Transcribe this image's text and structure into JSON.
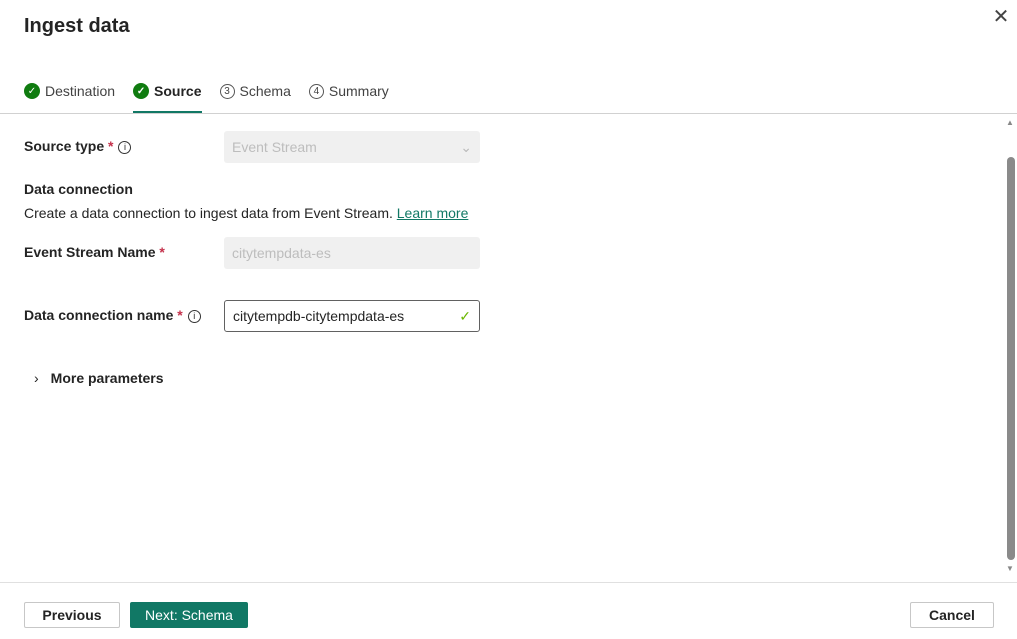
{
  "title": "Ingest data",
  "tabs": [
    {
      "label": "Destination",
      "state": "done"
    },
    {
      "label": "Source",
      "state": "active"
    },
    {
      "label": "Schema",
      "number": "3"
    },
    {
      "label": "Summary",
      "number": "4"
    }
  ],
  "form": {
    "source_type_label": "Source type",
    "source_type_value": "Event Stream",
    "data_connection_heading": "Data connection",
    "data_connection_desc": "Create a data connection to ingest data from Event Stream.",
    "learn_more": "Learn more",
    "event_stream_label": "Event Stream Name",
    "event_stream_value": "citytempdata-es",
    "connection_name_label": "Data connection name",
    "connection_name_value": "citytempdb-citytempdata-es",
    "more_parameters": "More parameters",
    "required_mark": "*"
  },
  "footer": {
    "previous": "Previous",
    "next": "Next: Schema",
    "cancel": "Cancel"
  },
  "colors": {
    "accent": "#117865",
    "success": "#107c10",
    "required": "#c4314b"
  }
}
